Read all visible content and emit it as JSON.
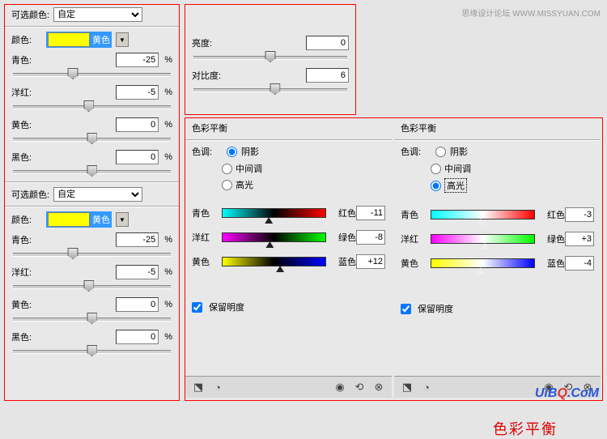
{
  "watermarks": {
    "top": "思缘设计论坛 WWW.MISSYUAN.COM",
    "bottom_a": "UiB",
    "bottom_b": "Q",
    "bottom_c": ".CoM"
  },
  "selective": {
    "title_label": "可选颜色:",
    "preset": "自定",
    "color_label": "颜色:",
    "swatch_text": "黄色",
    "sliders": [
      {
        "label": "青色:",
        "value": "-25"
      },
      {
        "label": "洋红:",
        "value": "-5"
      },
      {
        "label": "黄色:",
        "value": "0"
      },
      {
        "label": "黑色:",
        "value": "0"
      }
    ],
    "pct": "%"
  },
  "bc": {
    "brightness_label": "亮度:",
    "brightness": "0",
    "contrast_label": "对比度:",
    "contrast": "6"
  },
  "cb": {
    "title": "色彩平衡",
    "tone_label": "色调:",
    "tones": {
      "shadows": "阴影",
      "mid": "中间调",
      "hi": "高光"
    },
    "pairs": [
      {
        "l": "青色",
        "r": "红色"
      },
      {
        "l": "洋红",
        "r": "绿色"
      },
      {
        "l": "黄色",
        "r": "蓝色"
      }
    ],
    "preserve": "保留明度",
    "left_vals": [
      "-11",
      "-8",
      "+12"
    ],
    "right_vals": [
      "-3",
      "+3",
      "-4"
    ],
    "overlay": "色彩平衡"
  }
}
